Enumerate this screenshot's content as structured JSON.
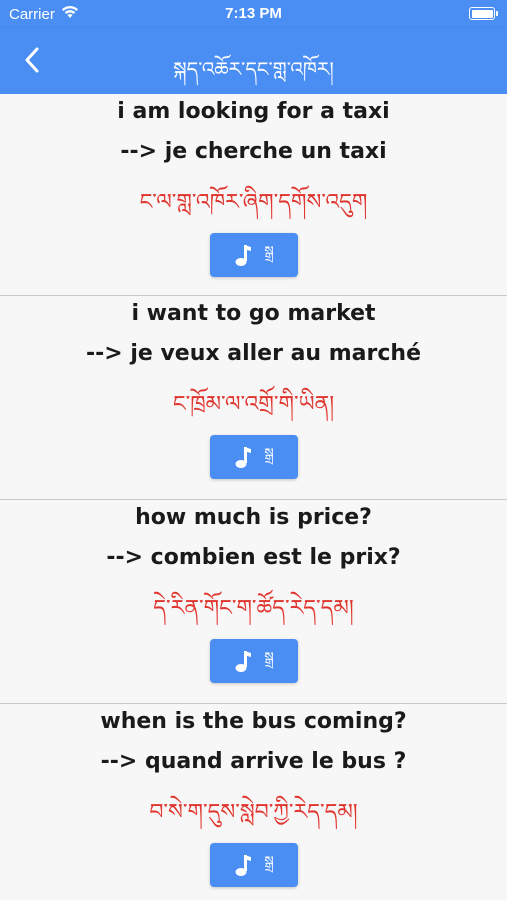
{
  "status": {
    "carrier": "Carrier",
    "time": "7:13 PM"
  },
  "nav": {
    "title": "སྐད་འཆོར་དང་གླ་འཁོར།"
  },
  "phrases": [
    {
      "english": "i am looking for a taxi",
      "french": "--> je cherche un taxi",
      "tibetan": "ང་ལ་གླ་འཁོར་ཞིག་དགོས་འདུག",
      "button_label": "སྒྲ"
    },
    {
      "english": "i want to go market",
      "french": "--> je veux aller au marché",
      "tibetan": "ང་ཁྲོམ་ལ་འགྲོ་གི་ཡིན།",
      "button_label": "སྒྲ"
    },
    {
      "english": "how much is price?",
      "french": "--> combien est le prix?",
      "tibetan": "དེ་རིན་གོང་ག་ཚོད་རེད་དམ།",
      "button_label": "སྒྲ"
    },
    {
      "english": "when is the bus coming?",
      "french": "--> quand arrive le bus ?",
      "tibetan": "བ་སེ་ག་དུས་སླེབ་ཀྱི་རེད་དམ།",
      "button_label": "སྒྲ"
    }
  ],
  "colors": {
    "accent": "#4a8ef3",
    "tibetan_text": "#e0342d"
  }
}
